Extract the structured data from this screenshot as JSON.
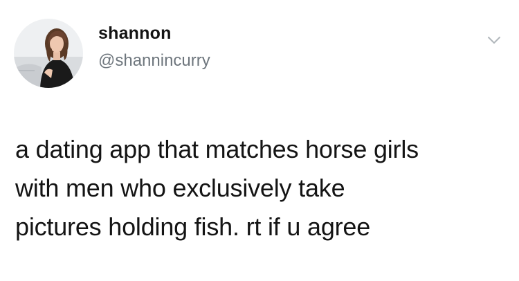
{
  "tweet": {
    "author": {
      "display_name": "shannon",
      "handle": "@shannincurry",
      "avatar_icon": "profile-photo"
    },
    "menu_icon": "chevron-down-icon",
    "text_lines": [
      "a dating app that matches horse girls",
      "with men who exclusively take",
      "pictures holding fish. rt if u agree"
    ]
  },
  "colors": {
    "text": "#141414",
    "handle": "#6e767d",
    "chevron": "#b0b6bb",
    "background": "#ffffff"
  }
}
